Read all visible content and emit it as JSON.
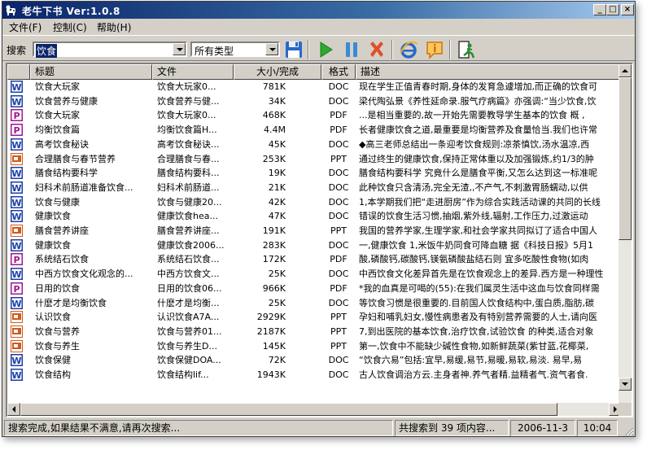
{
  "window": {
    "title": "老牛下书 Ver:1.0.8",
    "minimize_label": "_",
    "maximize_label": "□",
    "close_label": "×"
  },
  "menu": [
    {
      "label": "文件(F)"
    },
    {
      "label": "控制(C)"
    },
    {
      "label": "帮助(H)"
    }
  ],
  "toolbar": {
    "search_label": "搜索",
    "search_value": "饮食",
    "type_value": "所有类型",
    "buttons": [
      {
        "name": "save-icon"
      },
      {
        "name": "play-icon",
        "color": "#2fa82f"
      },
      {
        "name": "pause-icon",
        "color": "#3a8ad8"
      },
      {
        "name": "stop-icon",
        "color": "#e0502a"
      },
      {
        "name": "ie-icon",
        "color": "#2a68c8"
      },
      {
        "name": "info-icon",
        "color": "#f0a020"
      },
      {
        "name": "exit-icon",
        "color": "#2a8a2a"
      }
    ]
  },
  "columns": [
    {
      "label": ""
    },
    {
      "label": "标题"
    },
    {
      "label": "文件"
    },
    {
      "label": "大小/完成"
    },
    {
      "label": "格式"
    },
    {
      "label": "描述"
    }
  ],
  "rows": [
    {
      "type": "DOC",
      "title": "饮食大玩家",
      "file": "饮食大玩家0...",
      "size": "781K",
      "format": "DOC",
      "desc": "现在学生正值青春时期,身体的发育急遽增加,而正确的饮食可"
    },
    {
      "type": "DOC",
      "title": "饮食营养与健康",
      "file": "饮食营养与健...",
      "size": "34K",
      "format": "DOC",
      "desc": "梁代陶弘景《养性延命录.服气疗病篇》亦强调:“当少饮食,饮"
    },
    {
      "type": "PDF",
      "title": "饮食大玩家",
      "file": "饮食大玩家0...",
      "size": "468K",
      "format": "PDF",
      "desc": "...是相当重要的,故一开始先需要教导学生基本的饮食 概 ,"
    },
    {
      "type": "PDF",
      "title": "均衡饮食篇",
      "file": "均衡饮食篇H...",
      "size": "4.4M",
      "format": "PDF",
      "desc": "长者健康饮食之道,最重要是均衡营养及食量恰当.我们也许常"
    },
    {
      "type": "DOC",
      "title": "高考饮食秘诀",
      "file": "高考饮食秘诀...",
      "size": "45K",
      "format": "DOC",
      "desc": "◆高三老师总结出一条迎考饮食规则:凉茶慎饮,汤水温凉,西"
    },
    {
      "type": "PPT",
      "title": "合理膳食与春节营养",
      "file": "合理膳食与春...",
      "size": "253K",
      "format": "PPT",
      "desc": "通过终生的健康饮食,保持正常体重以及加强锻炼,约1/3的肿"
    },
    {
      "type": "DOC",
      "title": "膳食结构要科学",
      "file": "膳食结构要科...",
      "size": "19K",
      "format": "DOC",
      "desc": "膳食结构要科学 究竟什么是膳食平衡,又怎么达到这一标准呢"
    },
    {
      "type": "DOC",
      "title": "妇科术前肠道准备饮食...",
      "file": "妇科术前肠道...",
      "size": "21K",
      "format": "DOC",
      "desc": "此种饮食只含清汤,完全无渣,,不产气,不刺激胃肠蠕动,以供"
    },
    {
      "type": "DOC",
      "title": "饮食与健康",
      "file": "饮食与健康20...",
      "size": "42K",
      "format": "DOC",
      "desc": "1,本学期我们把“走进厨房”作为综合实践活动课的共同的长线"
    },
    {
      "type": "DOC",
      "title": "健康饮食",
      "file": "健康饮食hea...",
      "size": "47K",
      "format": "DOC",
      "desc": "错误的饮食生活习惯,抽烟,紫外线,辐射,工作压力,过激运动"
    },
    {
      "type": "PPT",
      "title": "膳食营养讲座",
      "file": "膳食营养讲座...",
      "size": "191K",
      "format": "PPT",
      "desc": "我国的营养学家,生理学家,和社会学家共同拟订了适合中国人"
    },
    {
      "type": "DOC",
      "title": "健康饮食",
      "file": "健康饮食2006...",
      "size": "283K",
      "format": "DOC",
      "desc": "一,健康饮食 1,米饭牛奶同食可降血糖 据《科技日报》5月1"
    },
    {
      "type": "PDF",
      "title": "系统结石饮食",
      "file": "系统结石饮食...",
      "size": "172K",
      "format": "PDF",
      "desc": "酸,磷酸钙,碳酸钙,镁氨磷酸盐结石则 宜多吃酸性食物(如肉"
    },
    {
      "type": "DOC",
      "title": "中西方饮食文化观念的...",
      "file": "中西方饮食文...",
      "size": "25K",
      "format": "DOC",
      "desc": "中西饮食文化差异首先是在饮食观念上的差异.西方是一种理性"
    },
    {
      "type": "PDF",
      "title": "日用的饮食",
      "file": "日用的饮食06...",
      "size": "966K",
      "format": "PDF",
      "desc": "*我的血真是可喝的(55):在我们属灵生活中这血与饮食同样需"
    },
    {
      "type": "DOC",
      "title": "什麽才是均衡饮食",
      "file": "什麽才是均衡...",
      "size": "25K",
      "format": "DOC",
      "desc": "等饮食习惯是很重要的.目前国人饮食结构中,蛋白质,脂肪,碳"
    },
    {
      "type": "PPT",
      "title": "认识饮食",
      "file": "认识饮食A7A...",
      "size": "2929K",
      "format": "PPT",
      "desc": "孕妇和哺乳妇女,慢性病患者及有特别营养需要的人士,请向医"
    },
    {
      "type": "PPT",
      "title": "饮食与营养",
      "file": "饮食与营养01...",
      "size": "2187K",
      "format": "PPT",
      "desc": "7,到出医院的基本饮食,治疗饮食,试验饮食 的种类,适合对象"
    },
    {
      "type": "PPT",
      "title": "饮食与养生",
      "file": "饮食与养生D...",
      "size": "145K",
      "format": "PPT",
      "desc": "第一,饮食中不能缺少碱性食物,如新鲜蔬菜(紫甘蓝,花椰菜,"
    },
    {
      "type": "DOC",
      "title": "饮食保健",
      "file": "饮食保健DOA...",
      "size": "72K",
      "format": "DOC",
      "desc": "“饮食六易”包括:宜早,易缓,易节,易暖,易软,易淡. 易早,易"
    },
    {
      "type": "DOC",
      "title": "饮食结构",
      "file": "饮食结构lif...",
      "size": "1943K",
      "format": "DOC",
      "desc": "古人饮食调治方云.主身者神.养气者精.益精者气.资气者食."
    }
  ],
  "status": {
    "message": "搜索完成,如果结果不满意,请再次搜索...",
    "result": "共搜索到 39 项内容...",
    "date": "2006-11-3",
    "time": "10:04"
  },
  "colors": {
    "doc": "#1c3fa8",
    "pdf": "#a01890",
    "ppt": "#d05a1c",
    "selection": "#0a246a",
    "face": "#d4d0c8"
  }
}
